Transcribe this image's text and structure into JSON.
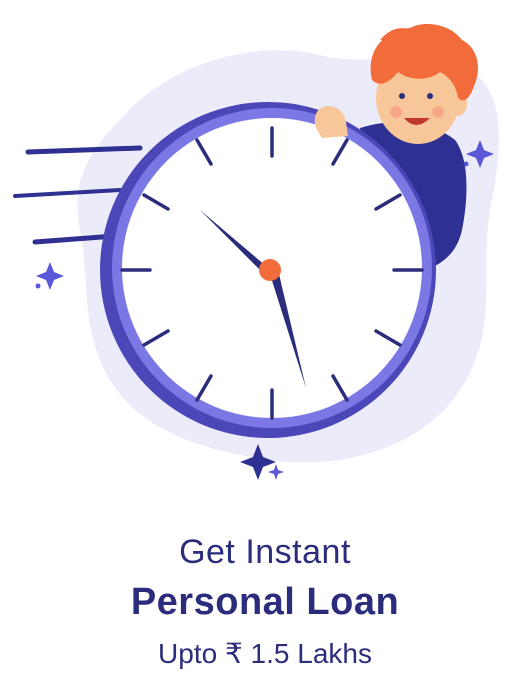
{
  "promo": {
    "line1": "Get Instant",
    "line2": "Personal Loan",
    "line3": "Upto ₹ 1.5 Lakhs"
  },
  "colors": {
    "text": "#2b2d7c",
    "clock_ring": "#7b78e6",
    "clock_ring_dark": "#4b47b8",
    "blob": "#ecebfa",
    "hair": "#f26b3a",
    "skin": "#f7c79a",
    "sweater": "#2e3192",
    "sparkle": "#5b57d9"
  },
  "icons": [
    "clock-icon",
    "sparkle-icon",
    "person-illustration"
  ]
}
